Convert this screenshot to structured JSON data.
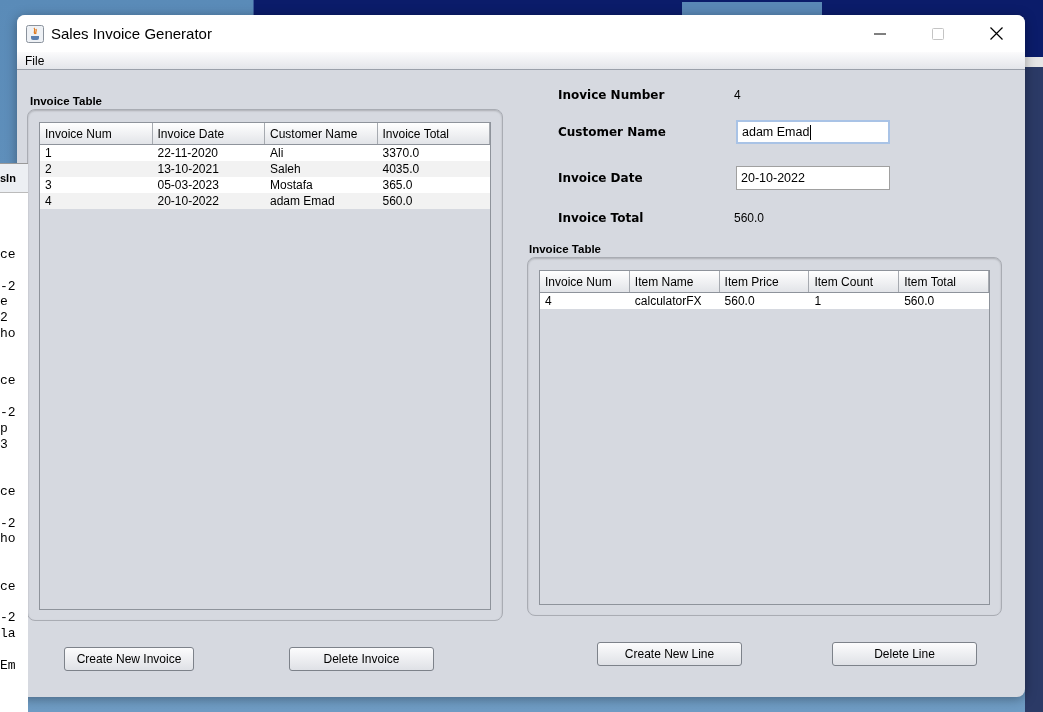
{
  "desktop": {
    "editor": {
      "tab": "sIn",
      "records": [
        {
          "heading": "ce",
          "lines": [
            "-2",
            "e",
            "2",
            "ho"
          ]
        },
        {
          "heading": "ce",
          "lines": [
            "-2",
            "p",
            "3"
          ]
        },
        {
          "heading": "ce",
          "lines": [
            "-2",
            "ho"
          ]
        },
        {
          "heading": "ce",
          "lines": [
            "-2",
            "la"
          ]
        }
      ],
      "trailer": "Em"
    }
  },
  "window": {
    "title": "Sales Invoice Generator"
  },
  "menu": [
    "File"
  ],
  "invoices": {
    "label": "Invoice Table",
    "columns": [
      "Invoice Num",
      "Invoice Date",
      "Customer Name",
      "Invoice Total"
    ],
    "rows": [
      [
        "1",
        "22-11-2020",
        "Ali",
        "3370.0"
      ],
      [
        "2",
        "13-10-2021",
        "Saleh",
        "4035.0"
      ],
      [
        "3",
        "05-03-2023",
        "Mostafa",
        "365.0"
      ],
      [
        "4",
        "20-10-2022",
        "adam Emad",
        "560.0"
      ]
    ]
  },
  "details": {
    "fields": [
      {
        "label": "Inovice Number",
        "kind": "text",
        "value": "4"
      },
      {
        "label": "Customer Name",
        "kind": "input",
        "value": "adam Emad",
        "focused": true
      },
      {
        "label": "Invoice Date",
        "kind": "input",
        "value": "20-10-2022",
        "focused": false
      },
      {
        "label": "Invoice Total",
        "kind": "text",
        "value": "560.0"
      }
    ]
  },
  "items": {
    "label": "Invoice Table",
    "columns": [
      "Invoice Num",
      "Item Name",
      "Item Price",
      "Item Count",
      "Item Total"
    ],
    "rows": [
      [
        "4",
        "calculatorFX",
        "560.0",
        "1",
        "560.0"
      ]
    ]
  },
  "buttons": {
    "left": [
      "Create New Invoice",
      "Delete Invoice"
    ],
    "right": [
      "Create New Line",
      "Delete Line"
    ]
  }
}
